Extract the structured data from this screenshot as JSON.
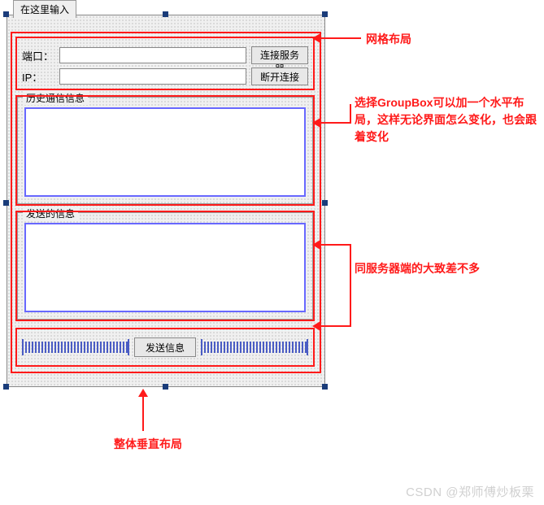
{
  "tab": {
    "label": "在这里输入"
  },
  "grid": {
    "port_label": "端口：",
    "ip_label": "IP：",
    "connect_btn": "连接服务器",
    "disconnect_btn": "断开连接"
  },
  "groupbox": {
    "history_title": "历史通信信息",
    "send_title": "发送的信息"
  },
  "button_row": {
    "send_btn": "发送信息"
  },
  "annotations": {
    "a1": "网格布局",
    "a2": "选择GroupBox可以加一个水平布局，这样无论界面怎么变化，也会跟着变化",
    "a3": "同服务器端的大致差不多",
    "a4": "整体垂直布局"
  },
  "watermark": "CSDN @郑师傅炒板栗"
}
